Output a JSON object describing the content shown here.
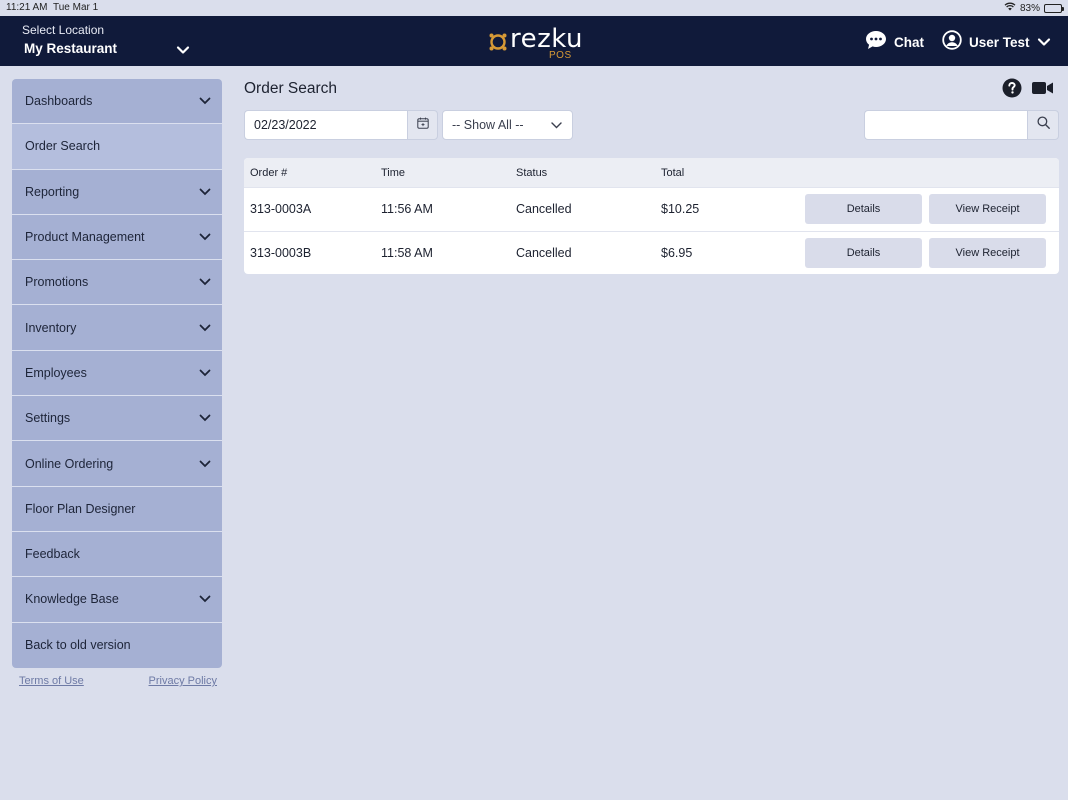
{
  "status_bar": {
    "time": "11:21 AM",
    "date": "Tue Mar 1",
    "battery": "83%",
    "battery_level": 0.83
  },
  "header": {
    "location_label": "Select Location",
    "location_name": "My Restaurant",
    "brand_word": "rezku",
    "brand_sub": "POS",
    "chat_label": "Chat",
    "user_label": "User Test",
    "colors": {
      "background": "#101a3a",
      "brand_accent": "#d79a36"
    }
  },
  "sidebar": {
    "items": [
      {
        "label": "Dashboards",
        "expandable": true
      },
      {
        "label": "Order Search",
        "expandable": false,
        "active": true
      },
      {
        "label": "Reporting",
        "expandable": true
      },
      {
        "label": "Product Management",
        "expandable": true
      },
      {
        "label": "Promotions",
        "expandable": true
      },
      {
        "label": "Inventory",
        "expandable": true
      },
      {
        "label": "Employees",
        "expandable": true
      },
      {
        "label": "Settings",
        "expandable": true
      },
      {
        "label": "Online Ordering",
        "expandable": true
      },
      {
        "label": "Floor Plan Designer",
        "expandable": false
      },
      {
        "label": "Feedback",
        "expandable": false
      },
      {
        "label": "Knowledge Base",
        "expandable": true
      },
      {
        "label": "Back to old version",
        "expandable": false
      }
    ],
    "terms_label": "Terms of Use",
    "privacy_label": "Privacy Policy"
  },
  "main": {
    "title": "Order Search",
    "date_value": "02/23/2022",
    "status_filter": "-- Show All --",
    "search_value": "",
    "table": {
      "headers": [
        "Order #",
        "Time",
        "Status",
        "Total"
      ],
      "rows": [
        {
          "order": "313-0003A",
          "time": "11:56 AM",
          "status": "Cancelled",
          "total": "$10.25"
        },
        {
          "order": "313-0003B",
          "time": "11:58 AM",
          "status": "Cancelled",
          "total": "$6.95"
        }
      ],
      "details_label": "Details",
      "receipt_label": "View Receipt"
    }
  }
}
